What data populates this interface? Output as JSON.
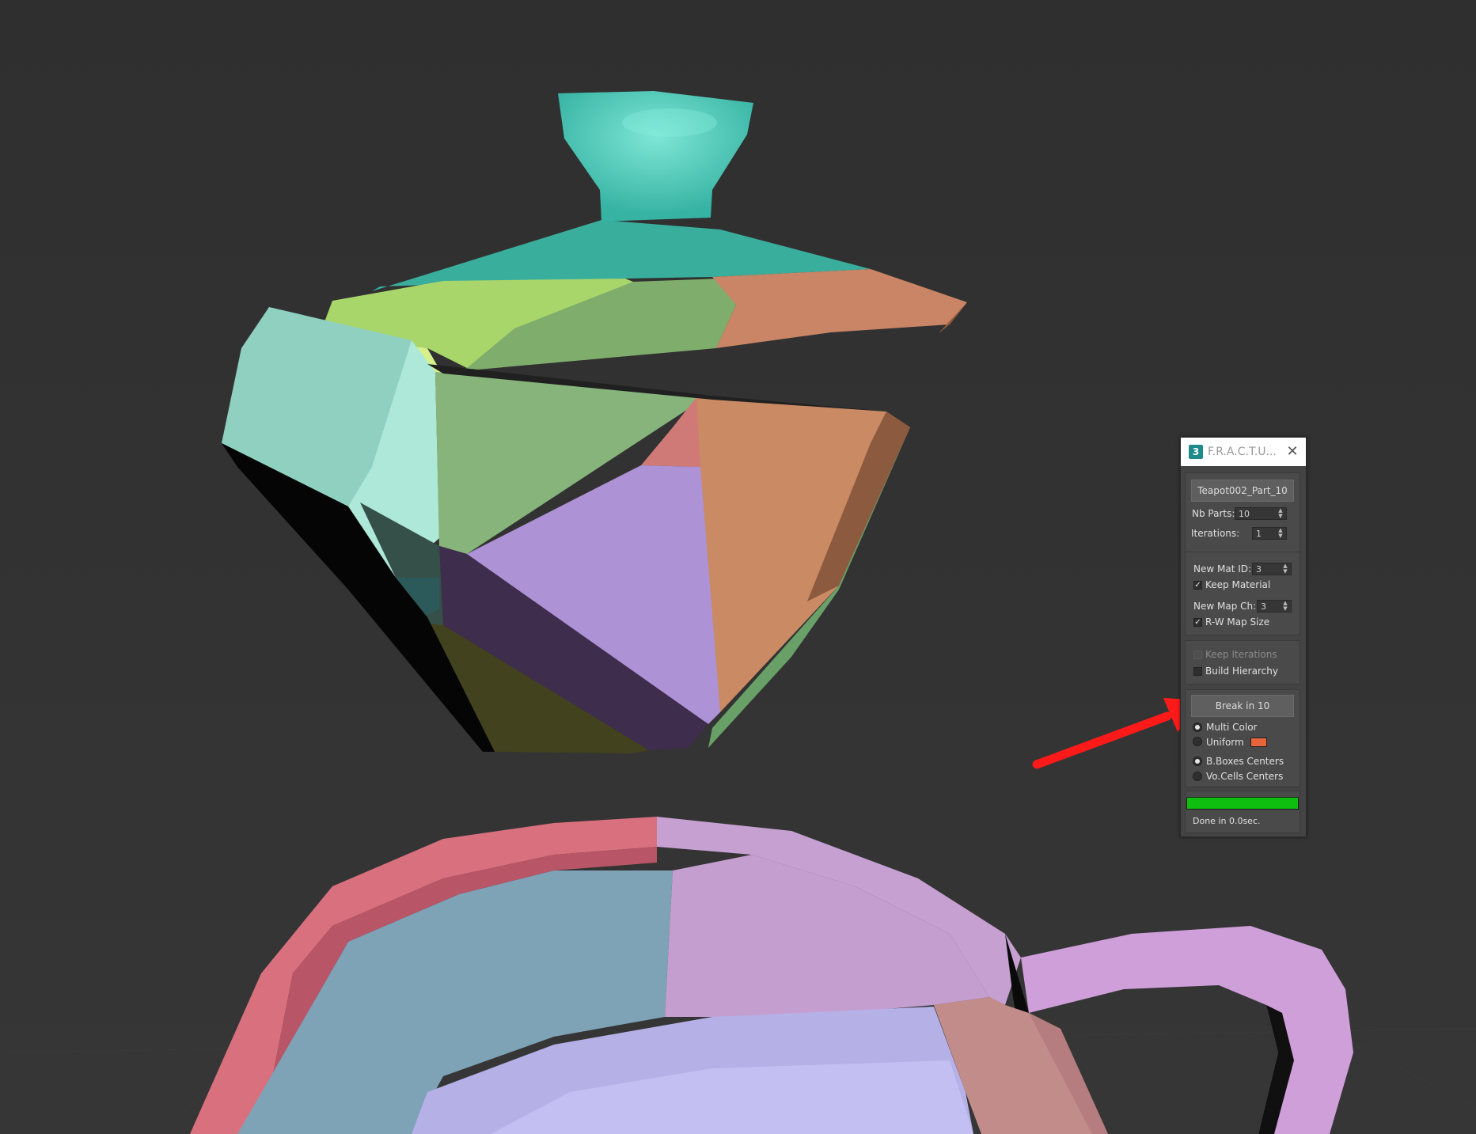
{
  "panel": {
    "title": "F.R.A.C.T.U...",
    "close_glyph": "✕",
    "object_button_label": "Teapot002_Part_10",
    "nb_parts": {
      "label": "Nb Parts:",
      "value": "10"
    },
    "iterations": {
      "label": "Iterations:",
      "value": "1"
    },
    "new_mat_id": {
      "label": "New Mat ID:",
      "value": "3"
    },
    "keep_material": {
      "label": "Keep Material",
      "checked": true
    },
    "new_map_ch": {
      "label": "New Map Ch:",
      "value": "3"
    },
    "rw_map_size": {
      "label": "R-W Map Size",
      "checked": true
    },
    "keep_iterations": {
      "label": "Keep Iterations",
      "checked": false,
      "enabled": false
    },
    "build_hierarchy": {
      "label": "Build Hierarchy",
      "checked": false
    },
    "break_button_label": "Break in 10",
    "color_mode": {
      "options": [
        "Multi Color",
        "Uniform"
      ],
      "selected": "Multi Color"
    },
    "uniform_swatch_color": "#e8643a",
    "center_mode": {
      "options": [
        "B.Boxes Centers",
        "Vo.Cells Centers"
      ],
      "selected": "B.Boxes Centers"
    },
    "progress": {
      "percent": 100,
      "color": "#0fbf0f"
    },
    "status_text": "Done in 0.0sec."
  },
  "viewport": {
    "background": "#2f2f2f",
    "annotation_arrow_color": "#ff1a1a"
  }
}
